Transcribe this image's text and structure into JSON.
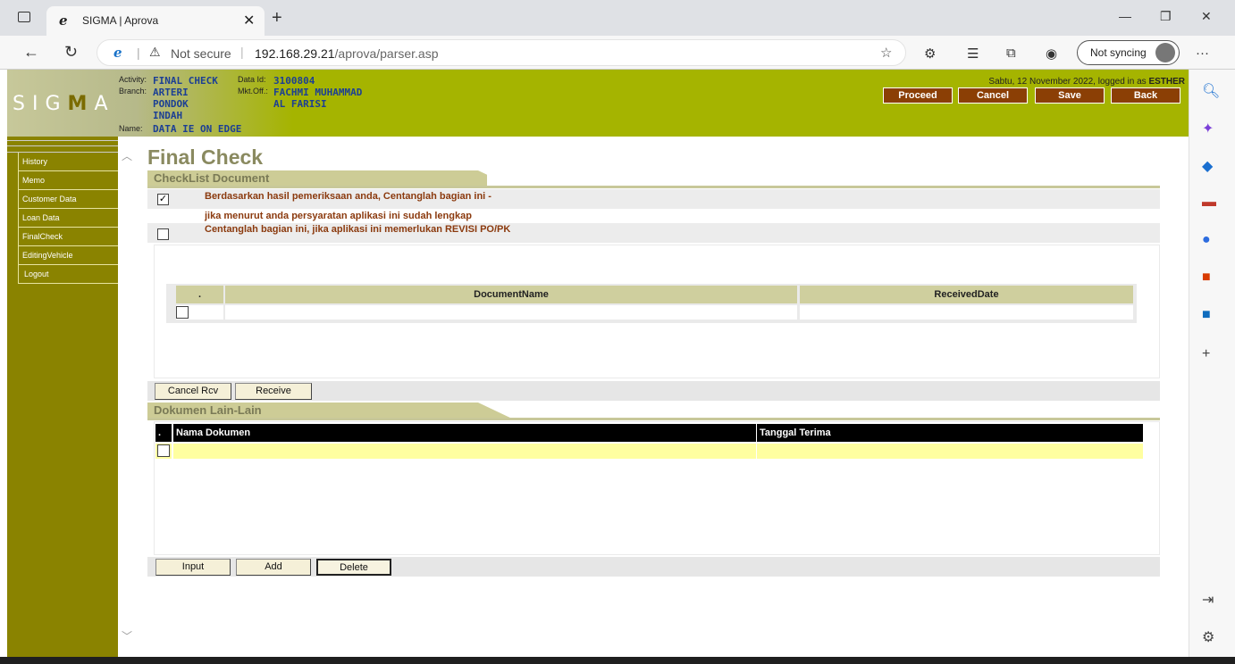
{
  "browser": {
    "tab_title": "SIGMA | Aprova",
    "favicon": "e",
    "url_security": "Not secure",
    "url_host": "192.168.29.21",
    "url_path": "/aprova/parser.asp",
    "sync_label": "Not syncing"
  },
  "header": {
    "logo": "SIGMA",
    "activity_label": "Activity:",
    "activity": "FINAL CHECK",
    "branch_label": "Branch:",
    "branch": "ARTERI PONDOK INDAH",
    "name_label": "Name:",
    "name": "DATA IE ON EDGE",
    "data_id_label": "Data Id:",
    "data_id": "3100804",
    "mkt_off_label": "Mkt.Off.:",
    "mkt_off": "FACHMI MUHAMMAD AL FARISI",
    "date_text": "Sabtu, 12 November 2022, logged in as ",
    "user": "ESTHER",
    "buttons": [
      "Proceed",
      "Cancel",
      "Save",
      "Back"
    ]
  },
  "nav": {
    "items": [
      "History",
      "Memo",
      "Customer Data",
      "Loan Data",
      "FinalCheck",
      "EditingVehicle",
      "Logout"
    ]
  },
  "main": {
    "title": "Final Check",
    "checklist": {
      "heading": "CheckList Document",
      "item1_line1": "Berdasarkan hasil pemeriksaan anda, Centanglah bagian ini -",
      "item1_line2": "jika menurut anda persyaratan aplikasi ini sudah lengkap",
      "item1_checked": true,
      "item2": "Centanglah bagian ini, jika aplikasi ini memerlukan REVISI PO/PK",
      "item2_checked": false
    },
    "doc_table": {
      "headers": [
        ".",
        "DocumentName",
        "ReceivedDate"
      ]
    },
    "doc_buttons": [
      "Cancel Rcv",
      "Receive"
    ],
    "lain": {
      "heading": "Dokumen Lain-Lain",
      "headers": [
        ".",
        "Nama Dokumen",
        "Tanggal Terima"
      ]
    },
    "lain_buttons": [
      "Input",
      "Add",
      "Delete"
    ]
  }
}
